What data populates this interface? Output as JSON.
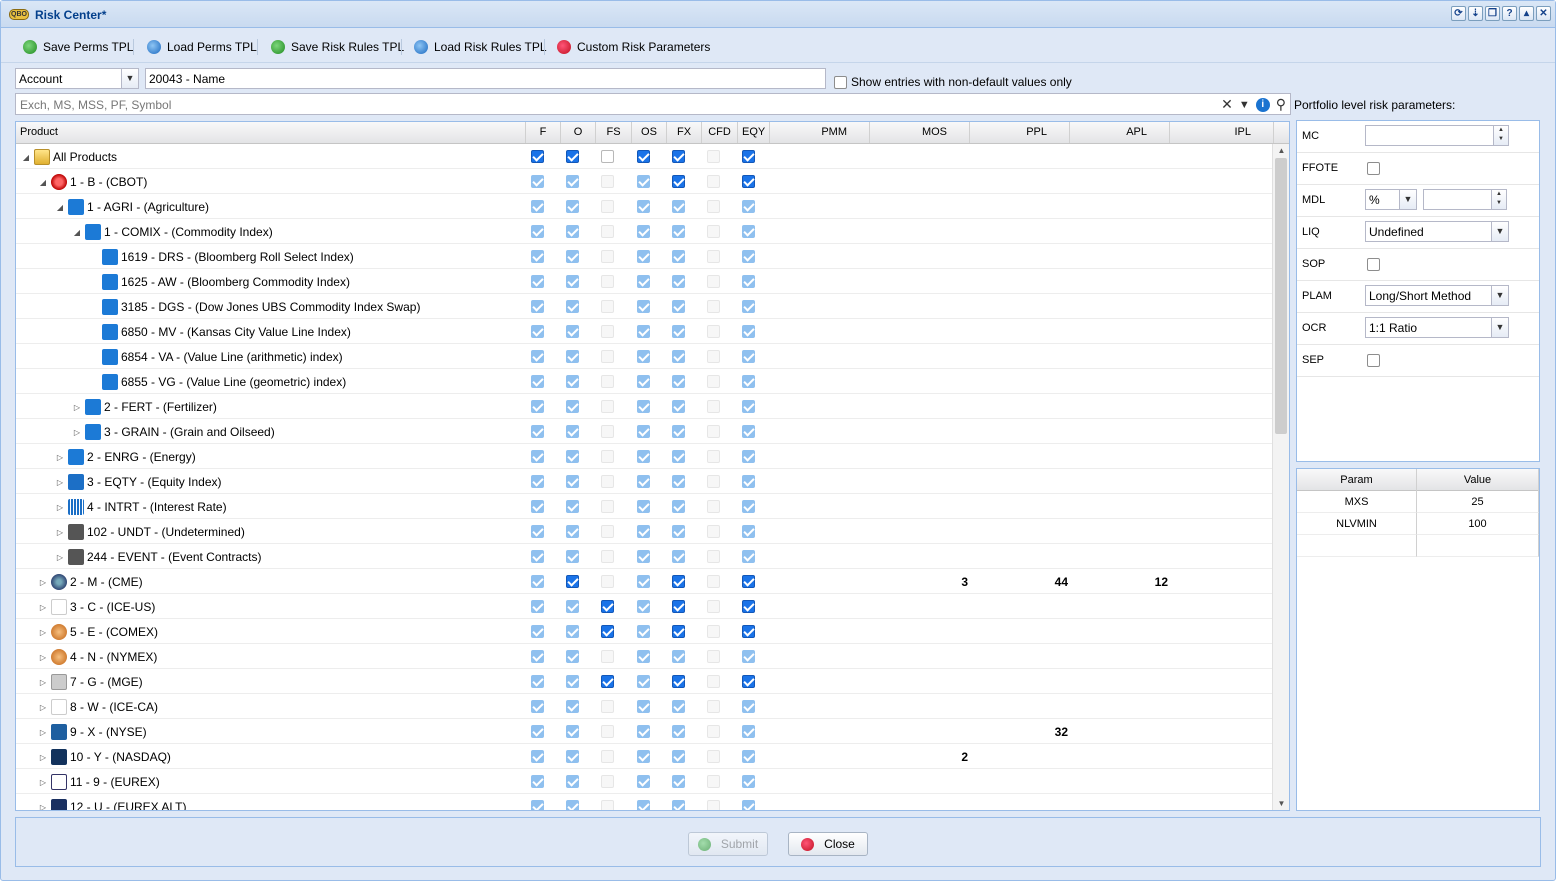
{
  "window": {
    "title": "Risk Center*",
    "logo_text": "QBO"
  },
  "toolbar": {
    "save_perms": "Save Perms TPL",
    "load_perms": "Load Perms TPL",
    "save_rules": "Save Risk Rules TPL",
    "load_rules": "Load Risk Rules TPL",
    "custom": "Custom Risk Parameters"
  },
  "filter": {
    "type_value": "Account",
    "account_value": "20043 - Name",
    "non_default_label": "Show entries with non-default values only",
    "search_placeholder": "Exch, MS, MSS, PF, Symbol"
  },
  "grid": {
    "columns": [
      "Product",
      "F",
      "O",
      "FS",
      "OS",
      "FX",
      "CFD",
      "EQY",
      "PMM",
      "MOS",
      "PPL",
      "APL",
      "IPL"
    ],
    "rows": [
      {
        "label": "All Products",
        "level": 0,
        "expand": "open",
        "icon": "folder-icon",
        "checks": [
          "on",
          "on",
          "off",
          "on",
          "on",
          "offl",
          "on"
        ],
        "mos": "",
        "ppl": "",
        "apl": ""
      },
      {
        "label": "1 - B - (CBOT)",
        "level": 1,
        "expand": "open",
        "icon": "cbot-icon",
        "checks": [
          "dim",
          "dim",
          "offl",
          "dim",
          "on",
          "offl",
          "on"
        ],
        "mos": "",
        "ppl": "",
        "apl": ""
      },
      {
        "label": "1 - AGRI - (Agriculture)",
        "level": 2,
        "expand": "open",
        "icon": "agri-icon",
        "checks": [
          "dim",
          "dim",
          "offl",
          "dim",
          "dim",
          "offl",
          "dim"
        ],
        "mos": "",
        "ppl": "",
        "apl": ""
      },
      {
        "label": "1 - COMIX - (Commodity Index)",
        "level": 3,
        "expand": "open",
        "icon": "agri-icon",
        "checks": [
          "dim",
          "dim",
          "offl",
          "dim",
          "dim",
          "offl",
          "dim"
        ],
        "mos": "",
        "ppl": "",
        "apl": ""
      },
      {
        "label": "1619 - DRS - (Bloomberg Roll Select Index)",
        "level": 4,
        "expand": "none",
        "icon": "agri-icon",
        "checks": [
          "dim",
          "dim",
          "offl",
          "dim",
          "dim",
          "offl",
          "dim"
        ],
        "mos": "",
        "ppl": "",
        "apl": ""
      },
      {
        "label": "1625 - AW - (Bloomberg Commodity Index)",
        "level": 4,
        "expand": "none",
        "icon": "agri-icon",
        "checks": [
          "dim",
          "dim",
          "offl",
          "dim",
          "dim",
          "offl",
          "dim"
        ],
        "mos": "",
        "ppl": "",
        "apl": ""
      },
      {
        "label": "3185 - DGS - (Dow Jones UBS Commodity Index Swap)",
        "level": 4,
        "expand": "none",
        "icon": "agri-icon",
        "checks": [
          "dim",
          "dim",
          "offl",
          "dim",
          "dim",
          "offl",
          "dim"
        ],
        "mos": "",
        "ppl": "",
        "apl": ""
      },
      {
        "label": "6850 - MV - (Kansas City Value Line Index)",
        "level": 4,
        "expand": "none",
        "icon": "agri-icon",
        "checks": [
          "dim",
          "dim",
          "offl",
          "dim",
          "dim",
          "offl",
          "dim"
        ],
        "mos": "",
        "ppl": "",
        "apl": ""
      },
      {
        "label": "6854 - VA - (Value Line (arithmetic) index)",
        "level": 4,
        "expand": "none",
        "icon": "agri-icon",
        "checks": [
          "dim",
          "dim",
          "offl",
          "dim",
          "dim",
          "offl",
          "dim"
        ],
        "mos": "",
        "ppl": "",
        "apl": ""
      },
      {
        "label": "6855 - VG - (Value Line (geometric) index)",
        "level": 4,
        "expand": "none",
        "icon": "agri-icon",
        "checks": [
          "dim",
          "dim",
          "offl",
          "dim",
          "dim",
          "offl",
          "dim"
        ],
        "mos": "",
        "ppl": "",
        "apl": ""
      },
      {
        "label": "2 - FERT - (Fertilizer)",
        "level": 3,
        "expand": "closed",
        "icon": "agri-icon",
        "checks": [
          "dim",
          "dim",
          "offl",
          "dim",
          "dim",
          "offl",
          "dim"
        ],
        "mos": "",
        "ppl": "",
        "apl": ""
      },
      {
        "label": "3 - GRAIN - (Grain and Oilseed)",
        "level": 3,
        "expand": "closed",
        "icon": "agri-icon",
        "checks": [
          "dim",
          "dim",
          "offl",
          "dim",
          "dim",
          "offl",
          "dim"
        ],
        "mos": "",
        "ppl": "",
        "apl": ""
      },
      {
        "label": "2 - ENRG - (Energy)",
        "level": 2,
        "expand": "closed",
        "icon": "energy-icon",
        "checks": [
          "dim",
          "dim",
          "offl",
          "dim",
          "dim",
          "offl",
          "dim"
        ],
        "mos": "",
        "ppl": "",
        "apl": ""
      },
      {
        "label": "3 - EQTY - (Equity Index)",
        "level": 2,
        "expand": "closed",
        "icon": "equity-icon",
        "checks": [
          "dim",
          "dim",
          "offl",
          "dim",
          "dim",
          "offl",
          "dim"
        ],
        "mos": "",
        "ppl": "",
        "apl": ""
      },
      {
        "label": "4 - INTRT - (Interest Rate)",
        "level": 2,
        "expand": "closed",
        "icon": "interest-icon",
        "checks": [
          "dim",
          "dim",
          "offl",
          "dim",
          "dim",
          "offl",
          "dim"
        ],
        "mos": "",
        "ppl": "",
        "apl": ""
      },
      {
        "label": "102 - UNDT - (Undetermined)",
        "level": 2,
        "expand": "closed",
        "icon": "question-icon",
        "checks": [
          "dim",
          "dim",
          "offl",
          "dim",
          "dim",
          "offl",
          "dim"
        ],
        "mos": "",
        "ppl": "",
        "apl": ""
      },
      {
        "label": "244 - EVENT - (Event Contracts)",
        "level": 2,
        "expand": "closed",
        "icon": "question-icon",
        "checks": [
          "dim",
          "dim",
          "offl",
          "dim",
          "dim",
          "offl",
          "dim"
        ],
        "mos": "",
        "ppl": "",
        "apl": ""
      },
      {
        "label": "2 - M - (CME)",
        "level": 1,
        "expand": "closed",
        "icon": "globe-icon",
        "checks": [
          "dim",
          "on",
          "offl",
          "dim",
          "on",
          "offl",
          "on"
        ],
        "mos": "3",
        "ppl": "44",
        "apl": "12"
      },
      {
        "label": "3 - C - (ICE-US)",
        "level": 1,
        "expand": "closed",
        "icon": "ice-icon",
        "checks": [
          "dim",
          "dim",
          "on",
          "dim",
          "on",
          "offl",
          "on"
        ],
        "mos": "",
        "ppl": "",
        "apl": ""
      },
      {
        "label": "5 - E - (COMEX)",
        "level": 1,
        "expand": "closed",
        "icon": "comex-icon",
        "checks": [
          "dim",
          "dim",
          "on",
          "dim",
          "on",
          "offl",
          "on"
        ],
        "mos": "",
        "ppl": "",
        "apl": ""
      },
      {
        "label": "4 - N - (NYMEX)",
        "level": 1,
        "expand": "closed",
        "icon": "comex-icon",
        "checks": [
          "dim",
          "dim",
          "offl",
          "dim",
          "dim",
          "offl",
          "dim"
        ],
        "mos": "",
        "ppl": "",
        "apl": ""
      },
      {
        "label": "7 - G - (MGE)",
        "level": 1,
        "expand": "closed",
        "icon": "mge-icon",
        "checks": [
          "dim",
          "dim",
          "on",
          "dim",
          "on",
          "offl",
          "on"
        ],
        "mos": "",
        "ppl": "",
        "apl": ""
      },
      {
        "label": "8 - W - (ICE-CA)",
        "level": 1,
        "expand": "closed",
        "icon": "ice-icon",
        "checks": [
          "dim",
          "dim",
          "offl",
          "dim",
          "dim",
          "offl",
          "dim"
        ],
        "mos": "",
        "ppl": "",
        "apl": ""
      },
      {
        "label": "9 - X - (NYSE)",
        "level": 1,
        "expand": "closed",
        "icon": "nyse-icon",
        "checks": [
          "dim",
          "dim",
          "offl",
          "dim",
          "dim",
          "offl",
          "dim"
        ],
        "mos": "",
        "ppl": "32",
        "apl": ""
      },
      {
        "label": "10 - Y - (NASDAQ)",
        "level": 1,
        "expand": "closed",
        "icon": "nasdaq-icon",
        "checks": [
          "dim",
          "dim",
          "offl",
          "dim",
          "dim",
          "offl",
          "dim"
        ],
        "mos": "2",
        "ppl": "",
        "apl": ""
      },
      {
        "label": "11 - 9 - (EUREX)",
        "level": 1,
        "expand": "closed",
        "icon": "eurex-icon",
        "checks": [
          "dim",
          "dim",
          "offl",
          "dim",
          "dim",
          "offl",
          "dim"
        ],
        "mos": "",
        "ppl": "",
        "apl": ""
      },
      {
        "label": "12 - U - (EUREX ALT)",
        "level": 1,
        "expand": "closed",
        "icon": "eurex-alt-icon",
        "checks": [
          "dim",
          "dim",
          "offl",
          "dim",
          "dim",
          "offl",
          "dim"
        ],
        "mos": "",
        "ppl": "",
        "apl": ""
      }
    ]
  },
  "portfolio": {
    "heading": "Portfolio level risk parameters:",
    "labels": {
      "mc": "MC",
      "ffote": "FFOTE",
      "mdl": "MDL",
      "liq": "LIQ",
      "sop": "SOP",
      "plam": "PLAM",
      "ocr": "OCR",
      "sep": "SEP"
    },
    "values": {
      "mc": "",
      "mdl_unit": "%",
      "mdl": "",
      "liq": "Undefined",
      "plam": "Long/Short Method",
      "ocr": "1:1 Ratio"
    },
    "checked": {
      "ffote": false,
      "sop": false,
      "sep": false
    }
  },
  "params": {
    "headers": [
      "Param",
      "Value"
    ],
    "rows": [
      {
        "param": "MXS",
        "value": "25"
      },
      {
        "param": "NLVMIN",
        "value": "100"
      }
    ]
  },
  "buttons": {
    "submit": "Submit",
    "close": "Close"
  }
}
